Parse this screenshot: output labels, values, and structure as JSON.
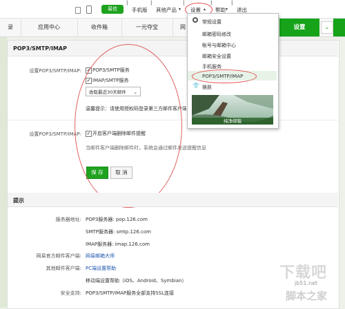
{
  "topbar": {
    "sms_label": "易信",
    "mobile_label": "手机版",
    "other_apps_label": "其他产品",
    "settings_label": "设置",
    "help_label": "帮助",
    "logout_label": "退出"
  },
  "nav": {
    "tabs": [
      "录",
      "应用中心",
      "收件箱",
      "一元夺宝",
      "网"
    ],
    "active_label": "设置",
    "more_icon": "chevron-down-icon"
  },
  "dropdown": {
    "items": [
      {
        "icon": "gear-icon",
        "label": "常规设置"
      },
      {
        "icon": "",
        "label": "邮箱密码修改"
      },
      {
        "icon": "",
        "label": "帐号与邮箱中心"
      },
      {
        "icon": "",
        "label": "邮箱安全设置"
      },
      {
        "icon": "",
        "label": "手机服务"
      },
      {
        "icon": "",
        "label": "POP3/SMTP/IMAP"
      },
      {
        "icon": "shirt-icon",
        "label": "换肤"
      }
    ],
    "skin_caption": "纯净邮箱"
  },
  "section1": {
    "title": "POP3/SMTP/IMAP",
    "row1_label": "设置POP3/SMTP/IMAP:",
    "pop3_smtp": "POP3/SMTP服务",
    "imap_smtp": "IMAP/SMTP服务",
    "select_value": "收取最近30天邮件",
    "tip": "温馨提示：请使用授权码登录第三方邮件客户端",
    "row2_label": "设置POP3/SMTP/IMAP:",
    "notify_label": "开启客户端删除邮件提醒",
    "notify_desc": "当邮件客户端删除邮件时，系统会通过邮件发送提醒信息",
    "save_label": "保 存",
    "cancel_label": "取 消"
  },
  "section2": {
    "title": "提示",
    "server_label": "服务器地址:",
    "pop3": "POP3服务器: pop.126.com",
    "smtp": "SMTP服务器: smtp.126.com",
    "imap": "IMAP服务器: imap.126.com",
    "official_label": "网易官方邮件客户端:",
    "official_value": "网易邮箱大师",
    "other_label": "其他邮件客户端:",
    "other_value": "PC端设置帮助",
    "mobile_value": "移动端设置帮助（iOS、Android、Symbian）",
    "security_label": "安全支持:",
    "security_value": "POP3/SMTP/IMAP服务全部支持SSL连接"
  },
  "watermark": {
    "line1": "下载吧",
    "line2": "jb51.net",
    "line3": "脚本之家"
  },
  "colors": {
    "accent_green": "#16a31a",
    "link_blue": "#1c55b0",
    "annotation_red": "#e24a4a"
  }
}
